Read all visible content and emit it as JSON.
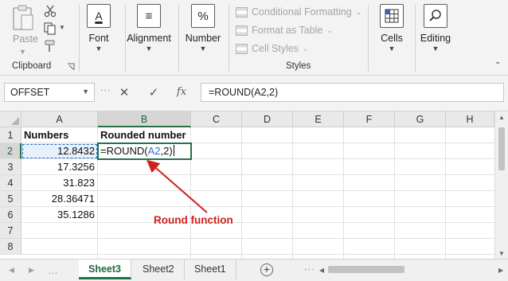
{
  "ribbon": {
    "clipboard": {
      "paste_label": "Paste",
      "group_label": "Clipboard"
    },
    "font": {
      "label": "Font",
      "icon_glyph": "A"
    },
    "alignment": {
      "label": "Alignment",
      "icon_glyph": "≡"
    },
    "number": {
      "label": "Number",
      "icon_glyph": "%"
    },
    "styles": {
      "items": [
        {
          "label": "Conditional Formatting",
          "icon": "conditional-formatting-icon"
        },
        {
          "label": "Format as Table",
          "icon": "format-as-table-icon"
        },
        {
          "label": "Cell Styles",
          "icon": "cell-styles-icon"
        }
      ],
      "group_label": "Styles"
    },
    "cells": {
      "label": "Cells"
    },
    "editing": {
      "label": "Editing"
    }
  },
  "formula_bar": {
    "name_box": "OFFSET",
    "fx_label": "fx",
    "formula": "=ROUND(A2,2)"
  },
  "grid": {
    "columns": [
      "A",
      "B",
      "C",
      "D",
      "E",
      "F",
      "G",
      "H"
    ],
    "rows": [
      "1",
      "2",
      "3",
      "4",
      "5",
      "6",
      "7",
      "8"
    ],
    "cells": {
      "A1": "Numbers",
      "B1": "Rounded number",
      "A2": "12.8432",
      "A3": "17.3256",
      "A4": "31.823",
      "A5": "28.36471",
      "A6": "35.1286"
    },
    "editing_cell": {
      "prefix": "=ROUND(",
      "ref": "A2",
      "suffix": ",2)"
    }
  },
  "annotation": {
    "text": "Round function",
    "color": "#d0201a"
  },
  "sheets": {
    "tabs": [
      "Sheet3",
      "Sheet2",
      "Sheet1"
    ],
    "active": "Sheet3"
  },
  "colors": {
    "excel_green": "#217346",
    "reference_blue": "#2f6fc9"
  }
}
